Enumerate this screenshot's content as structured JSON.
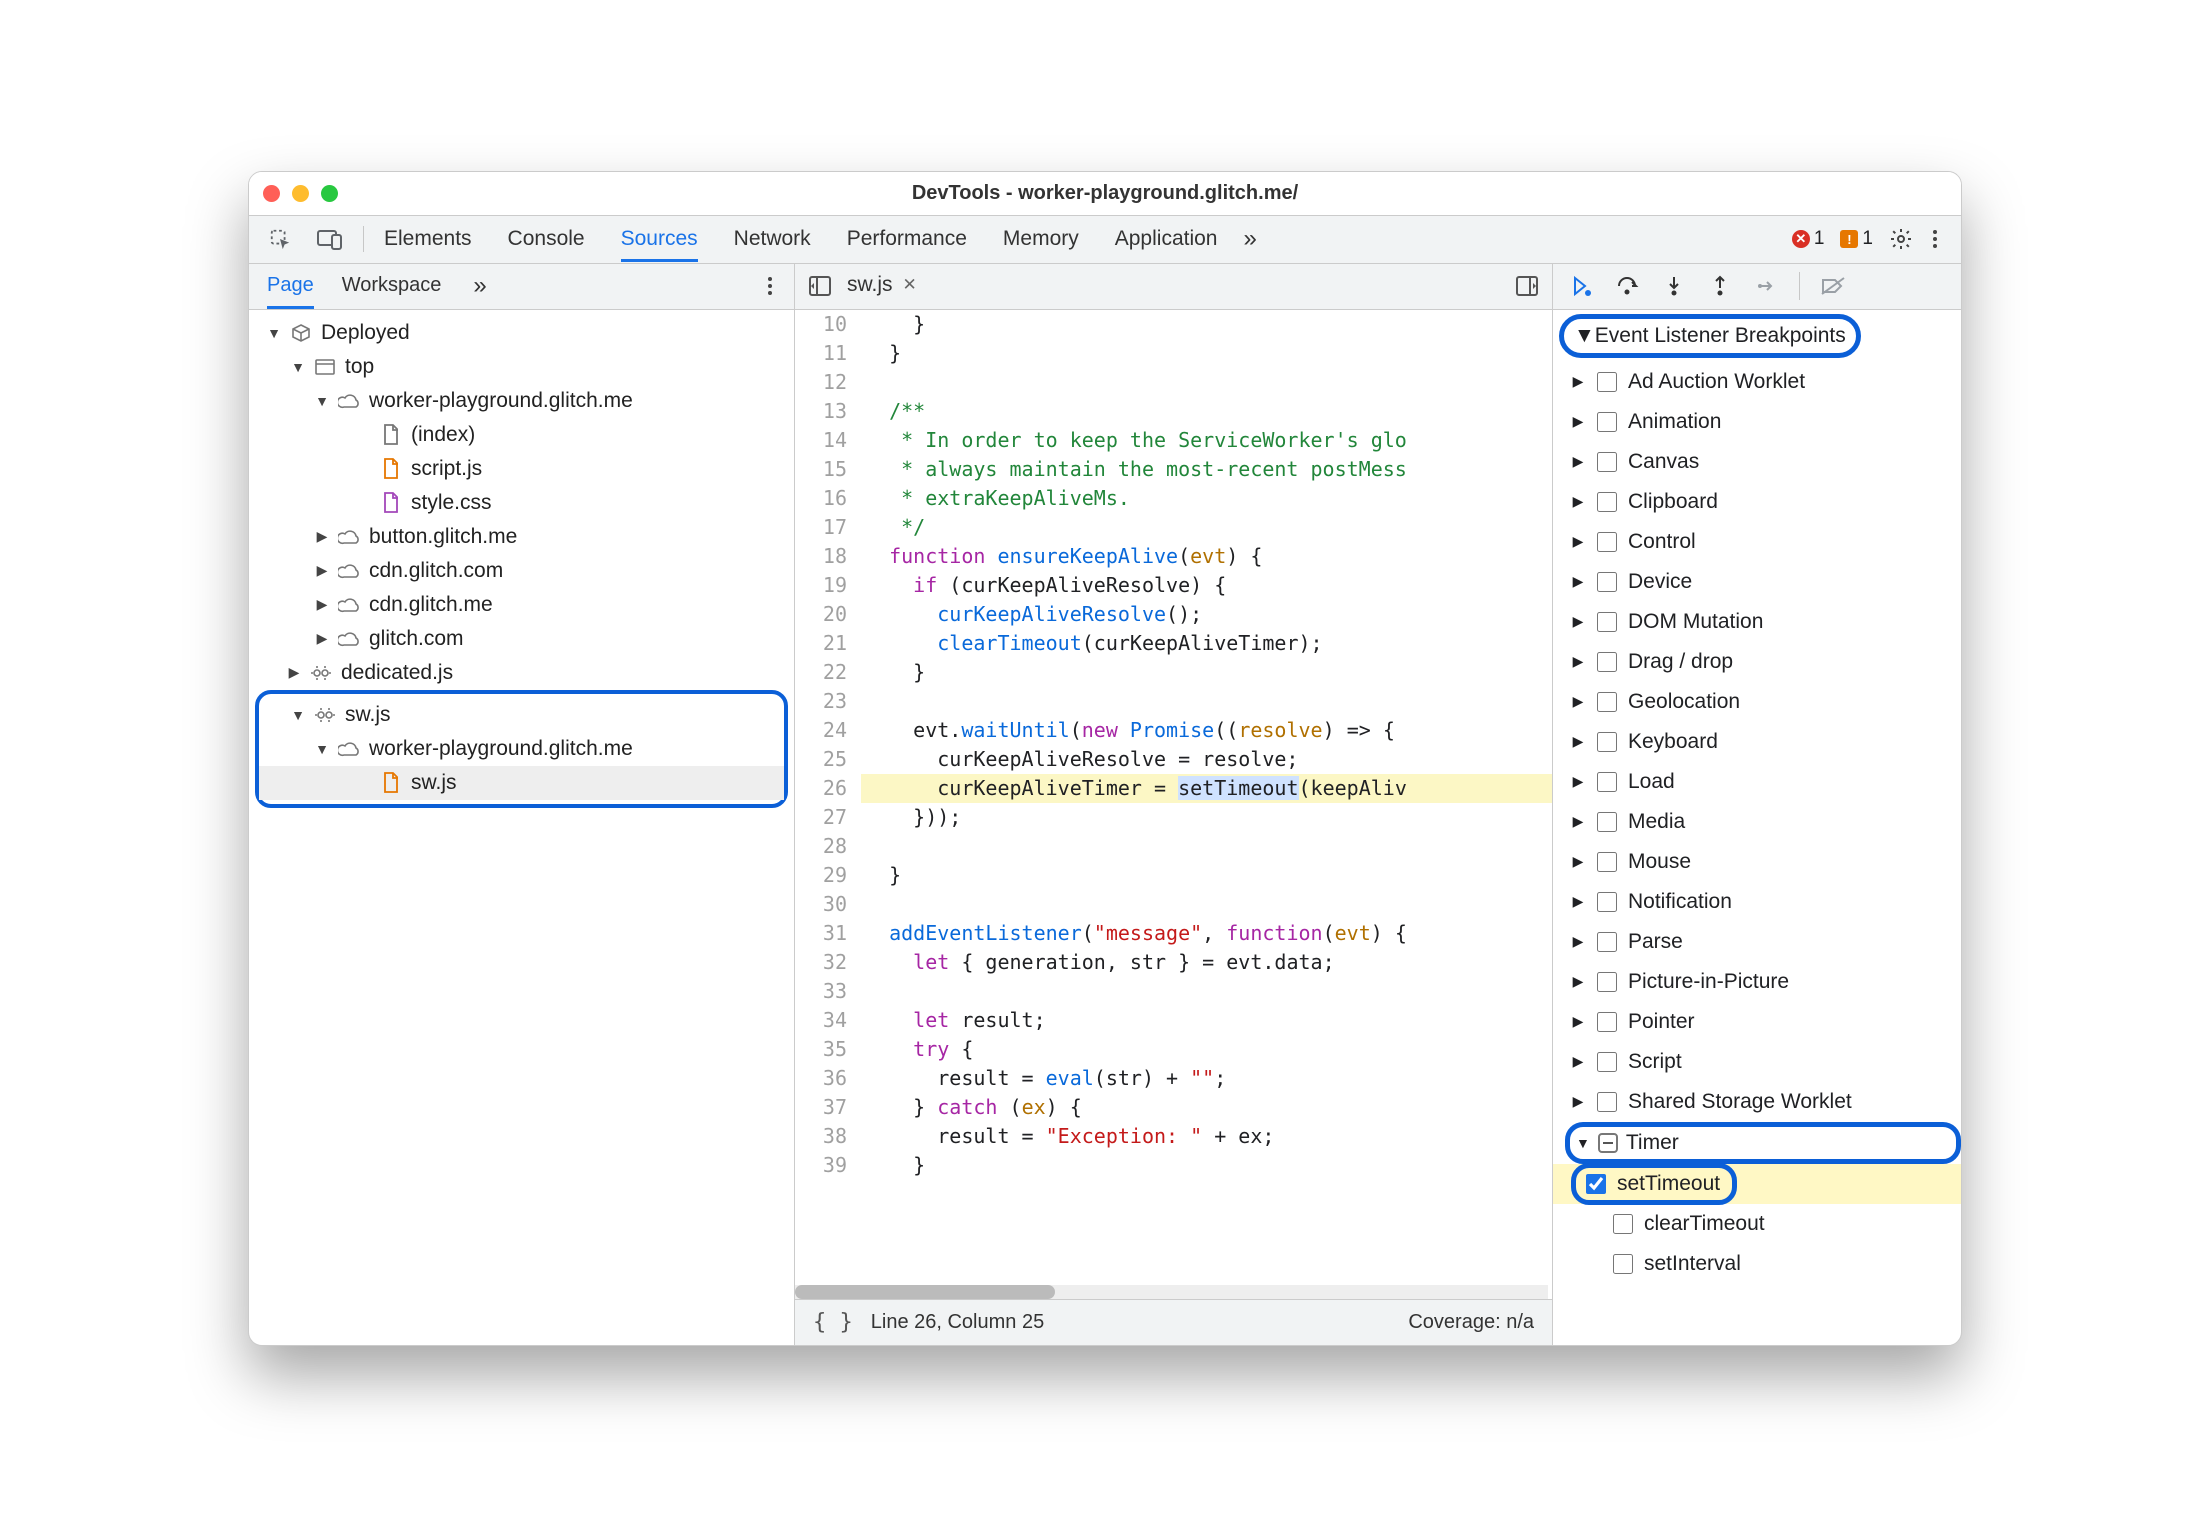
{
  "window": {
    "title": "DevTools - worker-playground.glitch.me/"
  },
  "main_tabs": [
    "Elements",
    "Console",
    "Sources",
    "Network",
    "Performance",
    "Memory",
    "Application"
  ],
  "main_active": "Sources",
  "error_count": "1",
  "warn_count": "1",
  "nav_tabs": [
    "Page",
    "Workspace"
  ],
  "nav_active": "Page",
  "tree": {
    "root": "Deployed",
    "top": "top",
    "domain1": "worker-playground.glitch.me",
    "files1": [
      "(index)",
      "script.js",
      "style.css"
    ],
    "domains_collapsed": [
      "button.glitch.me",
      "cdn.glitch.com",
      "cdn.glitch.me",
      "glitch.com"
    ],
    "dedicated": "dedicated.js",
    "sw_root": "sw.js",
    "sw_domain": "worker-playground.glitch.me",
    "sw_file": "sw.js"
  },
  "editor": {
    "filename": "sw.js",
    "lines": [
      {
        "n": 10,
        "html": "    }"
      },
      {
        "n": 11,
        "html": "  }"
      },
      {
        "n": 12,
        "html": ""
      },
      {
        "n": 13,
        "html": "  <span class='cm'>/**</span>"
      },
      {
        "n": 14,
        "html": "<span class='cm'>   * In order to keep the ServiceWorker's glo</span>"
      },
      {
        "n": 15,
        "html": "<span class='cm'>   * always maintain the most-recent postMess</span>"
      },
      {
        "n": 16,
        "html": "<span class='cm'>   * extraKeepAliveMs.</span>"
      },
      {
        "n": 17,
        "html": "<span class='cm'>   */</span>"
      },
      {
        "n": 18,
        "html": "  <span class='kw'>function</span> <span class='fn'>ensureKeepAlive</span>(<span class='pa'>evt</span>) {"
      },
      {
        "n": 19,
        "html": "    <span class='kw'>if</span> (curKeepAliveResolve) {"
      },
      {
        "n": 20,
        "html": "      <span class='fn'>curKeepAliveResolve</span>();"
      },
      {
        "n": 21,
        "html": "      <span class='fn'>clearTimeout</span>(curKeepAliveTimer);"
      },
      {
        "n": 22,
        "html": "    }"
      },
      {
        "n": 23,
        "html": ""
      },
      {
        "n": 24,
        "html": "    evt.<span class='fn'>waitUntil</span>(<span class='kw'>new</span> <span class='fn'>Promise</span>((<span class='pa'>resolve</span>) =&gt; {"
      },
      {
        "n": 25,
        "html": "      curKeepAliveResolve = resolve;"
      },
      {
        "n": 26,
        "hl": true,
        "html": "      curKeepAliveTimer = <span class='sel'>setTimeout</span>(keepAliv"
      },
      {
        "n": 27,
        "html": "    }));"
      },
      {
        "n": 28,
        "html": ""
      },
      {
        "n": 29,
        "html": "  }"
      },
      {
        "n": 30,
        "html": ""
      },
      {
        "n": 31,
        "html": "  <span class='fn'>addEventListener</span>(<span class='st'>\"message\"</span>, <span class='kw'>function</span>(<span class='pa'>evt</span>) {"
      },
      {
        "n": 32,
        "html": "    <span class='kw'>let</span> { generation, str } = evt.data;"
      },
      {
        "n": 33,
        "html": ""
      },
      {
        "n": 34,
        "html": "    <span class='kw'>let</span> result;"
      },
      {
        "n": 35,
        "html": "    <span class='kw'>try</span> {"
      },
      {
        "n": 36,
        "html": "      result = <span class='fn'>eval</span>(str) + <span class='st'>\"\"</span>;"
      },
      {
        "n": 37,
        "html": "    } <span class='kw'>catch</span> (<span class='pa'>ex</span>) {"
      },
      {
        "n": 38,
        "html": "      result = <span class='st'>\"Exception: \"</span> + ex;"
      },
      {
        "n": 39,
        "html": "    }"
      }
    ],
    "status_line": "Line 26, Column 25",
    "coverage": "Coverage: n/a"
  },
  "debugger": {
    "section_title": "Event Listener Breakpoints",
    "categories": [
      "Ad Auction Worklet",
      "Animation",
      "Canvas",
      "Clipboard",
      "Control",
      "Device",
      "DOM Mutation",
      "Drag / drop",
      "Geolocation",
      "Keyboard",
      "Load",
      "Media",
      "Mouse",
      "Notification",
      "Parse",
      "Picture-in-Picture",
      "Pointer",
      "Script",
      "Shared Storage Worklet"
    ],
    "timer_label": "Timer",
    "timer_items": [
      {
        "label": "setTimeout",
        "checked": true,
        "highlight": true
      },
      {
        "label": "clearTimeout",
        "checked": false
      },
      {
        "label": "setInterval",
        "checked": false
      }
    ]
  }
}
